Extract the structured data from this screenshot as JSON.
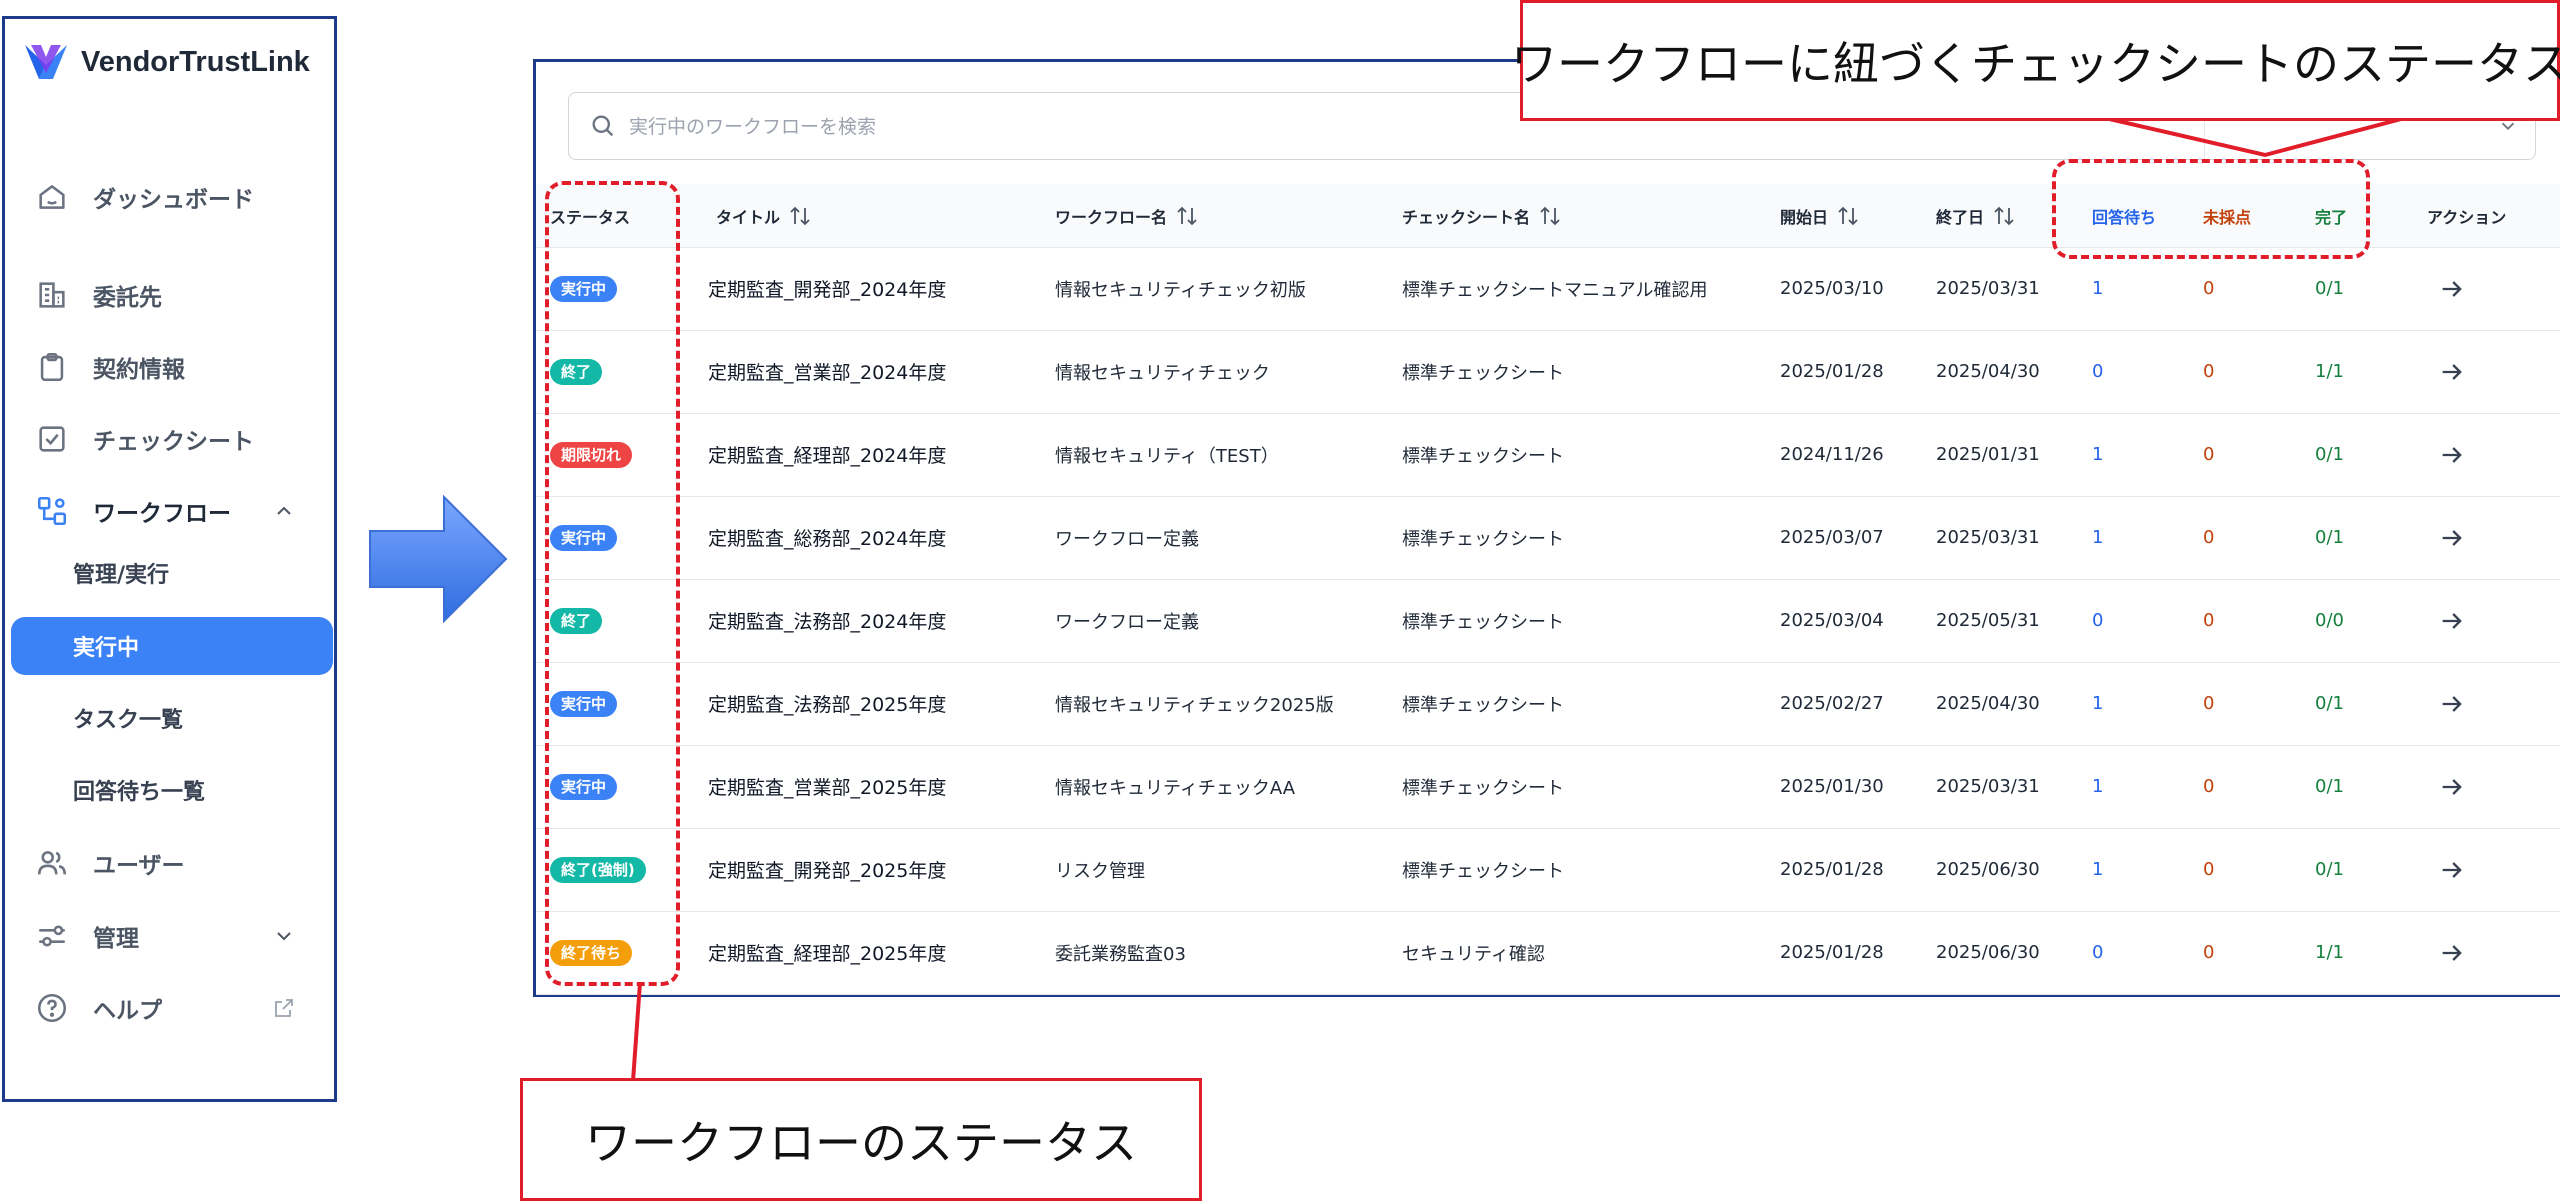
{
  "app": {
    "name": "VendorTrustLink"
  },
  "sidebar": {
    "items": [
      {
        "key": "dashboard",
        "label": "ダッシュボード",
        "icon": "home-icon"
      },
      {
        "key": "vendors",
        "label": "委託先",
        "icon": "building-icon"
      },
      {
        "key": "contracts",
        "label": "契約情報",
        "icon": "clipboard-icon"
      },
      {
        "key": "checksheets",
        "label": "チェックシート",
        "icon": "checkbox-icon"
      },
      {
        "key": "workflow",
        "label": "ワークフロー",
        "icon": "workflow-icon",
        "expanded": true
      },
      {
        "key": "users",
        "label": "ユーザー",
        "icon": "users-icon"
      },
      {
        "key": "admin",
        "label": "管理",
        "icon": "sliders-icon",
        "expanded": false
      },
      {
        "key": "help",
        "label": "ヘルプ",
        "icon": "help-icon",
        "external": true
      }
    ],
    "workflow_sub": [
      {
        "label": "管理/実行",
        "active": false
      },
      {
        "label": "実行中",
        "active": true
      },
      {
        "label": "タスク一覧",
        "active": false
      },
      {
        "label": "回答待ち一覧",
        "active": false
      }
    ]
  },
  "search": {
    "placeholder": "実行中のワークフローを検索"
  },
  "table": {
    "headers": {
      "status": "ステータス",
      "title": "タイトル",
      "workflow": "ワークフロー名",
      "checksheet": "チェックシート名",
      "start": "開始日",
      "end": "終了日",
      "waiting": "回答待ち",
      "unscored": "未採点",
      "done": "完了",
      "action": "アクション"
    },
    "rows": [
      {
        "status": "実行中",
        "status_type": "running",
        "title": "定期監査_開発部_2024年度",
        "workflow": "情報セキュリティチェック初版",
        "checksheet": "標準チェックシートマニュアル確認用",
        "start": "2025/03/10",
        "end": "2025/03/31",
        "waiting": "1",
        "unscored": "0",
        "done": "0/1"
      },
      {
        "status": "終了",
        "status_type": "done",
        "title": "定期監査_営業部_2024年度",
        "workflow": "情報セキュリティチェック",
        "checksheet": "標準チェックシート",
        "start": "2025/01/28",
        "end": "2025/04/30",
        "waiting": "0",
        "unscored": "0",
        "done": "1/1"
      },
      {
        "status": "期限切れ",
        "status_type": "expired",
        "title": "定期監査_経理部_2024年度",
        "workflow": "情報セキュリティ（TEST）",
        "checksheet": "標準チェックシート",
        "start": "2024/11/26",
        "end": "2025/01/31",
        "waiting": "1",
        "unscored": "0",
        "done": "0/1"
      },
      {
        "status": "実行中",
        "status_type": "running",
        "title": "定期監査_総務部_2024年度",
        "workflow": "ワークフロー定義",
        "checksheet": "標準チェックシート",
        "start": "2025/03/07",
        "end": "2025/03/31",
        "waiting": "1",
        "unscored": "0",
        "done": "0/1"
      },
      {
        "status": "終了",
        "status_type": "done",
        "title": "定期監査_法務部_2024年度",
        "workflow": "ワークフロー定義",
        "checksheet": "標準チェックシート",
        "start": "2025/03/04",
        "end": "2025/05/31",
        "waiting": "0",
        "unscored": "0",
        "done": "0/0"
      },
      {
        "status": "実行中",
        "status_type": "running",
        "title": "定期監査_法務部_2025年度",
        "workflow": "情報セキュリティチェック2025版",
        "checksheet": "標準チェックシート",
        "start": "2025/02/27",
        "end": "2025/04/30",
        "waiting": "1",
        "unscored": "0",
        "done": "0/1"
      },
      {
        "status": "実行中",
        "status_type": "running",
        "title": "定期監査_営業部_2025年度",
        "workflow": "情報セキュリティチェックAA",
        "checksheet": "標準チェックシート",
        "start": "2025/01/30",
        "end": "2025/03/31",
        "waiting": "1",
        "unscored": "0",
        "done": "0/1"
      },
      {
        "status": "終了(強制)",
        "status_type": "done",
        "title": "定期監査_開発部_2025年度",
        "workflow": "リスク管理",
        "checksheet": "標準チェックシート",
        "start": "2025/01/28",
        "end": "2025/06/30",
        "waiting": "1",
        "unscored": "0",
        "done": "0/1"
      },
      {
        "status": "終了待ち",
        "status_type": "waiting",
        "title": "定期監査_経理部_2025年度",
        "workflow": "委託業務監査03",
        "checksheet": "セキュリティ確認",
        "start": "2025/01/28",
        "end": "2025/06/30",
        "waiting": "0",
        "unscored": "0",
        "done": "1/1"
      }
    ]
  },
  "annotations": {
    "top": "ワークフローに紐づくチェックシートのステータス",
    "bottom": "ワークフローのステータス"
  },
  "colors": {
    "accent": "#3b82f6",
    "annotation": "#e11d2a",
    "running": "#3b82f6",
    "done": "#14b8a6",
    "expired": "#ef4444",
    "waiting": "#f59e0b"
  }
}
